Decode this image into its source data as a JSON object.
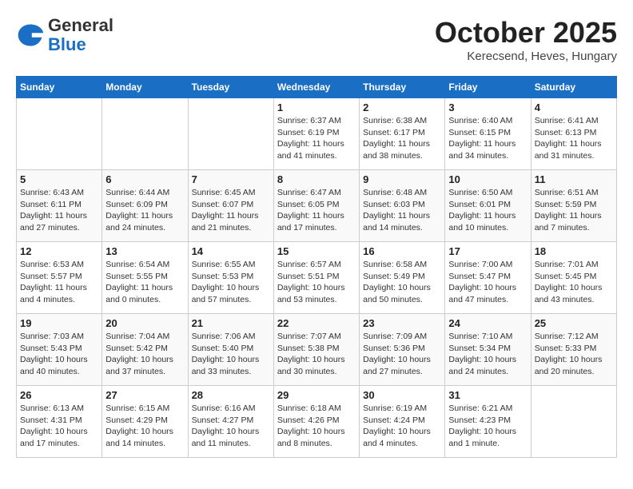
{
  "header": {
    "logo_line1": "General",
    "logo_line2": "Blue",
    "month": "October 2025",
    "location": "Kerecsend, Heves, Hungary"
  },
  "days_of_week": [
    "Sunday",
    "Monday",
    "Tuesday",
    "Wednesday",
    "Thursday",
    "Friday",
    "Saturday"
  ],
  "weeks": [
    [
      {
        "day": "",
        "info": ""
      },
      {
        "day": "",
        "info": ""
      },
      {
        "day": "",
        "info": ""
      },
      {
        "day": "1",
        "info": "Sunrise: 6:37 AM\nSunset: 6:19 PM\nDaylight: 11 hours and 41 minutes."
      },
      {
        "day": "2",
        "info": "Sunrise: 6:38 AM\nSunset: 6:17 PM\nDaylight: 11 hours and 38 minutes."
      },
      {
        "day": "3",
        "info": "Sunrise: 6:40 AM\nSunset: 6:15 PM\nDaylight: 11 hours and 34 minutes."
      },
      {
        "day": "4",
        "info": "Sunrise: 6:41 AM\nSunset: 6:13 PM\nDaylight: 11 hours and 31 minutes."
      }
    ],
    [
      {
        "day": "5",
        "info": "Sunrise: 6:43 AM\nSunset: 6:11 PM\nDaylight: 11 hours and 27 minutes."
      },
      {
        "day": "6",
        "info": "Sunrise: 6:44 AM\nSunset: 6:09 PM\nDaylight: 11 hours and 24 minutes."
      },
      {
        "day": "7",
        "info": "Sunrise: 6:45 AM\nSunset: 6:07 PM\nDaylight: 11 hours and 21 minutes."
      },
      {
        "day": "8",
        "info": "Sunrise: 6:47 AM\nSunset: 6:05 PM\nDaylight: 11 hours and 17 minutes."
      },
      {
        "day": "9",
        "info": "Sunrise: 6:48 AM\nSunset: 6:03 PM\nDaylight: 11 hours and 14 minutes."
      },
      {
        "day": "10",
        "info": "Sunrise: 6:50 AM\nSunset: 6:01 PM\nDaylight: 11 hours and 10 minutes."
      },
      {
        "day": "11",
        "info": "Sunrise: 6:51 AM\nSunset: 5:59 PM\nDaylight: 11 hours and 7 minutes."
      }
    ],
    [
      {
        "day": "12",
        "info": "Sunrise: 6:53 AM\nSunset: 5:57 PM\nDaylight: 11 hours and 4 minutes."
      },
      {
        "day": "13",
        "info": "Sunrise: 6:54 AM\nSunset: 5:55 PM\nDaylight: 11 hours and 0 minutes."
      },
      {
        "day": "14",
        "info": "Sunrise: 6:55 AM\nSunset: 5:53 PM\nDaylight: 10 hours and 57 minutes."
      },
      {
        "day": "15",
        "info": "Sunrise: 6:57 AM\nSunset: 5:51 PM\nDaylight: 10 hours and 53 minutes."
      },
      {
        "day": "16",
        "info": "Sunrise: 6:58 AM\nSunset: 5:49 PM\nDaylight: 10 hours and 50 minutes."
      },
      {
        "day": "17",
        "info": "Sunrise: 7:00 AM\nSunset: 5:47 PM\nDaylight: 10 hours and 47 minutes."
      },
      {
        "day": "18",
        "info": "Sunrise: 7:01 AM\nSunset: 5:45 PM\nDaylight: 10 hours and 43 minutes."
      }
    ],
    [
      {
        "day": "19",
        "info": "Sunrise: 7:03 AM\nSunset: 5:43 PM\nDaylight: 10 hours and 40 minutes."
      },
      {
        "day": "20",
        "info": "Sunrise: 7:04 AM\nSunset: 5:42 PM\nDaylight: 10 hours and 37 minutes."
      },
      {
        "day": "21",
        "info": "Sunrise: 7:06 AM\nSunset: 5:40 PM\nDaylight: 10 hours and 33 minutes."
      },
      {
        "day": "22",
        "info": "Sunrise: 7:07 AM\nSunset: 5:38 PM\nDaylight: 10 hours and 30 minutes."
      },
      {
        "day": "23",
        "info": "Sunrise: 7:09 AM\nSunset: 5:36 PM\nDaylight: 10 hours and 27 minutes."
      },
      {
        "day": "24",
        "info": "Sunrise: 7:10 AM\nSunset: 5:34 PM\nDaylight: 10 hours and 24 minutes."
      },
      {
        "day": "25",
        "info": "Sunrise: 7:12 AM\nSunset: 5:33 PM\nDaylight: 10 hours and 20 minutes."
      }
    ],
    [
      {
        "day": "26",
        "info": "Sunrise: 6:13 AM\nSunset: 4:31 PM\nDaylight: 10 hours and 17 minutes."
      },
      {
        "day": "27",
        "info": "Sunrise: 6:15 AM\nSunset: 4:29 PM\nDaylight: 10 hours and 14 minutes."
      },
      {
        "day": "28",
        "info": "Sunrise: 6:16 AM\nSunset: 4:27 PM\nDaylight: 10 hours and 11 minutes."
      },
      {
        "day": "29",
        "info": "Sunrise: 6:18 AM\nSunset: 4:26 PM\nDaylight: 10 hours and 8 minutes."
      },
      {
        "day": "30",
        "info": "Sunrise: 6:19 AM\nSunset: 4:24 PM\nDaylight: 10 hours and 4 minutes."
      },
      {
        "day": "31",
        "info": "Sunrise: 6:21 AM\nSunset: 4:23 PM\nDaylight: 10 hours and 1 minute."
      },
      {
        "day": "",
        "info": ""
      }
    ]
  ]
}
